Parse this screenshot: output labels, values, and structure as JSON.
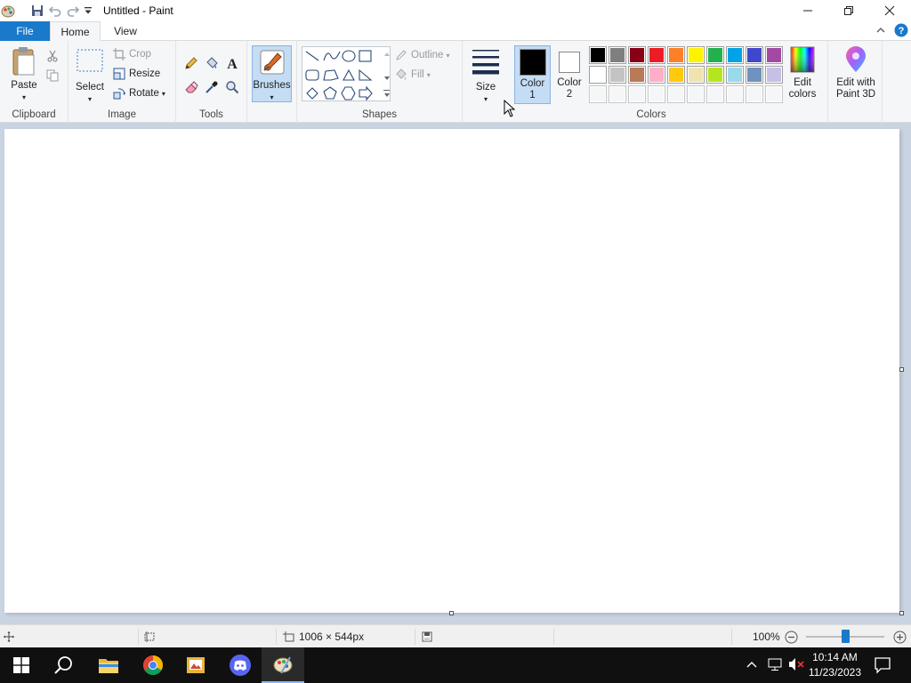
{
  "window": {
    "title": "Untitled - Paint"
  },
  "tabs": {
    "file": "File",
    "home": "Home",
    "view": "View"
  },
  "clipboard": {
    "paste": "Paste",
    "group": "Clipboard"
  },
  "image": {
    "select": "Select",
    "crop": "Crop",
    "resize": "Resize",
    "rotate": "Rotate",
    "group": "Image"
  },
  "tools": {
    "group": "Tools"
  },
  "brushes": {
    "label": "Brushes"
  },
  "shapes": {
    "outline": "Outline",
    "fill": "Fill",
    "group": "Shapes"
  },
  "size": {
    "label": "Size"
  },
  "colors": {
    "color1_line1": "Color",
    "color1_line2": "1",
    "color2_line1": "Color",
    "color2_line2": "2",
    "edit_line1": "Edit",
    "edit_line2": "colors",
    "group": "Colors",
    "paint3d_line1": "Edit with",
    "paint3d_line2": "Paint 3D",
    "color1_value": "#000000",
    "color2_value": "#ffffff",
    "palette_row1": [
      "#000000",
      "#7f7f7f",
      "#880015",
      "#ed1c24",
      "#ff7f27",
      "#fff200",
      "#22b14c",
      "#00a2e8",
      "#3f48cc",
      "#a349a4"
    ],
    "palette_row2": [
      "#ffffff",
      "#c3c3c3",
      "#b97a57",
      "#ffaec9",
      "#ffc90e",
      "#efe4b0",
      "#b5e61d",
      "#99d9ea",
      "#7092be",
      "#c8bfe7"
    ]
  },
  "status": {
    "dimensions": "1006 × 544px",
    "zoom": "100%"
  },
  "taskbar": {
    "time": "10:14 AM",
    "date": "11/23/2023"
  }
}
